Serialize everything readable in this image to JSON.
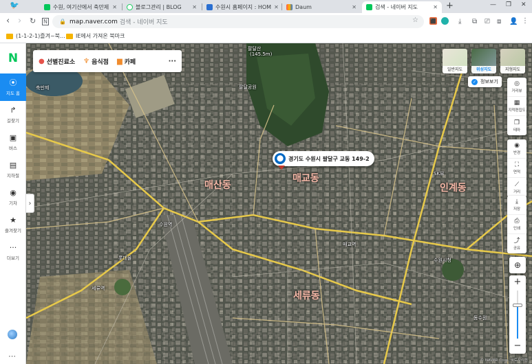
{
  "browser": {
    "tabs": [
      {
        "title": "수원, 여기산에서 축만제",
        "color": "#03c75a"
      },
      {
        "title": "블로그관리 | BLOG",
        "color": "#19ce60"
      },
      {
        "title": "수원시 홈페이지 : HOM",
        "color": "#2a6fd1"
      },
      {
        "title": "Daum",
        "color": "#ff5a4e"
      },
      {
        "title": "검색 - 네이버 지도",
        "color": "#03c75a"
      }
    ],
    "new_tab": "+",
    "window_controls": {
      "minimize": "—",
      "restore": "❐",
      "close": "✕"
    },
    "url_host": "map.naver.com",
    "url_rest": "검색 - 네이버 지도",
    "bookmarks": [
      {
        "label": "(1-1-2-1)즐겨~북..."
      },
      {
        "label": "IE에서 가져온 북마크"
      }
    ]
  },
  "nav": {
    "logo": "N",
    "items": [
      {
        "label": "지도 홈",
        "icon": "⦿"
      },
      {
        "label": "길찾기",
        "icon": "↱"
      },
      {
        "label": "버스",
        "icon": "▣"
      },
      {
        "label": "지하철",
        "icon": "▤"
      },
      {
        "label": "기차",
        "icon": "◉"
      },
      {
        "label": "즐겨찾기",
        "icon": "★"
      },
      {
        "label": "더보기",
        "icon": "···"
      }
    ],
    "collapse_glyph": "›"
  },
  "map": {
    "categories": [
      {
        "label": "선별진료소",
        "icon": "📍",
        "color": "#e5534b"
      },
      {
        "label": "음식점",
        "icon": "🍴",
        "color": "#f08c2e"
      },
      {
        "label": "카페",
        "icon": "☕",
        "color": "#f08c2e"
      }
    ],
    "more": "···",
    "pin_label": "경기도 수원시 팔달구 교동 149-2",
    "map_types": [
      {
        "label": "일반지도",
        "active": false
      },
      {
        "label": "위성지도",
        "active": true
      },
      {
        "label": "지형지도",
        "active": false
      }
    ],
    "info_toggle": "정보보기",
    "tools_top": [
      {
        "label": "거리뷰",
        "icon": "◎"
      },
      {
        "label": "지적편집도",
        "icon": "▦"
      },
      {
        "label": "테마",
        "icon": "❐"
      }
    ],
    "tools_mid": [
      {
        "label": "반경",
        "icon": "◉"
      },
      {
        "label": "면적",
        "icon": "⛶"
      },
      {
        "label": "거리",
        "icon": "⟋"
      }
    ],
    "tools_bottom": [
      {
        "label": "저장",
        "icon": "⤓"
      },
      {
        "label": "인쇄",
        "icon": "⎙"
      },
      {
        "label": "공유",
        "icon": "⤴"
      }
    ],
    "zoom_in": "+",
    "zoom_out": "−",
    "zoom_level": 0.7,
    "credit": "© NAVER Corp. 국토지리원",
    "labels": [
      {
        "text": "팔달산",
        "cls": ""
      },
      {
        "text": "(145.5m)",
        "cls": ""
      },
      {
        "text": "팔달공원",
        "cls": ""
      },
      {
        "text": "축만제",
        "cls": ""
      },
      {
        "text": "수원역",
        "cls": ""
      },
      {
        "text": "매교동",
        "cls": "big"
      },
      {
        "text": "세류동",
        "cls": "big"
      },
      {
        "text": "매산동",
        "cls": "big"
      },
      {
        "text": "인계동",
        "cls": "big"
      },
      {
        "text": "롯데몰",
        "cls": ""
      },
      {
        "text": "세류역",
        "cls": ""
      },
      {
        "text": "매교역",
        "cls": ""
      },
      {
        "text": "SK뷰",
        "cls": ""
      },
      {
        "text": "수원시청",
        "cls": ""
      },
      {
        "text": "동수원",
        "cls": ""
      }
    ]
  }
}
